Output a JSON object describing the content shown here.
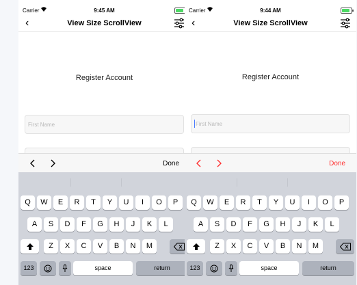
{
  "screens": [
    {
      "status": {
        "carrier": "Carrier",
        "time": "9:45 AM"
      },
      "nav": {
        "title": "View Size ScrollView"
      },
      "heading": "Register Account",
      "field_placeholder": "First Name",
      "toolbar": {
        "done": "Done",
        "accent": "#000000"
      },
      "field_focused": false
    },
    {
      "status": {
        "carrier": "Carrier",
        "time": "9:44 AM"
      },
      "nav": {
        "title": "View Size ScrollView"
      },
      "heading": "Register Account",
      "field_placeholder": "First Name",
      "toolbar": {
        "done": "Done",
        "accent": "#ff2d2d"
      },
      "field_focused": true
    }
  ],
  "keyboard": {
    "row1": [
      "Q",
      "W",
      "E",
      "R",
      "T",
      "Y",
      "U",
      "I",
      "O",
      "P"
    ],
    "row2": [
      "A",
      "S",
      "D",
      "F",
      "G",
      "H",
      "J",
      "K",
      "L"
    ],
    "row3": [
      "Z",
      "X",
      "C",
      "V",
      "B",
      "N",
      "M"
    ],
    "numbers_key": "123",
    "space_key": "space",
    "return_key": "return"
  },
  "icons": {
    "back": "chevron-left-icon",
    "settings": "sliders-icon",
    "prev": "chevron-left-icon",
    "next": "chevron-right-icon",
    "shift": "shift-arrow-icon",
    "delete": "backspace-icon",
    "emoji": "emoji-icon",
    "dictation": "microphone-icon"
  }
}
